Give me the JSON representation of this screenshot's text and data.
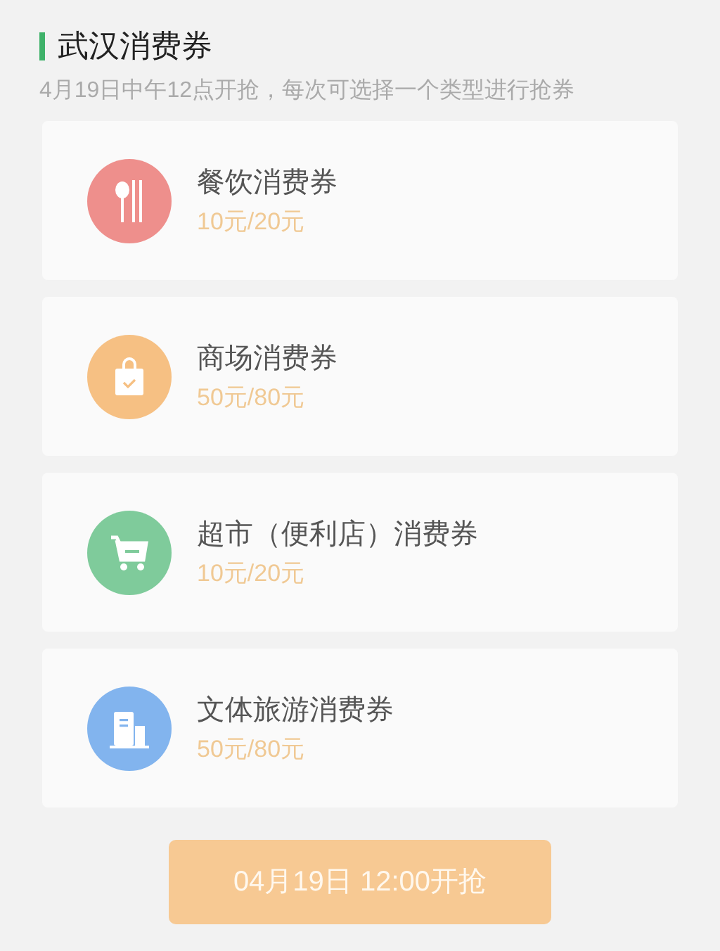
{
  "header": {
    "title": "武汉消费券",
    "subtitle": "4月19日中午12点开抢，每次可选择一个类型进行抢券"
  },
  "coupons": [
    {
      "kind": "dining",
      "color": "#ee8f8c",
      "name": "餐饮消费券",
      "amount": "10元/20元"
    },
    {
      "kind": "mall",
      "color": "#f6c083",
      "name": "商场消费券",
      "amount": "50元/80元"
    },
    {
      "kind": "supermarket",
      "color": "#7fcb9b",
      "name": "超市（便利店）消费券",
      "amount": "10元/20元"
    },
    {
      "kind": "culture",
      "color": "#82b4ee",
      "name": "文体旅游消费券",
      "amount": "50元/80元"
    }
  ],
  "button": {
    "label": "04月19日 12:00开抢",
    "disabled": true
  }
}
